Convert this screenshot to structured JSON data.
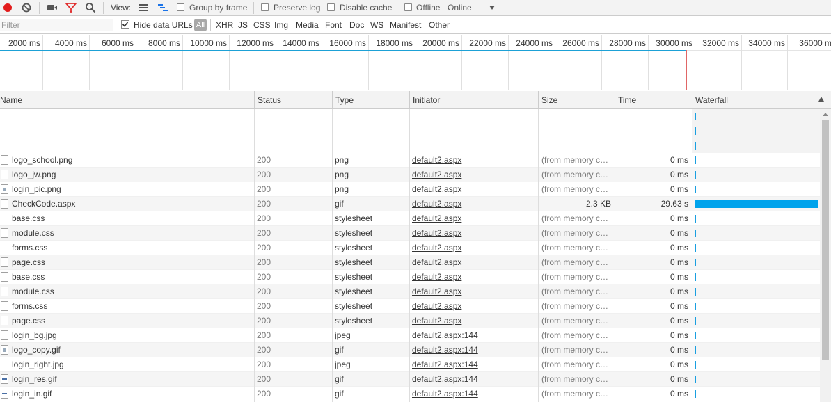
{
  "toolbar": {
    "view_label": "View:",
    "group_by_frame_label": "Group by frame",
    "preserve_log_label": "Preserve log",
    "disable_cache_label": "Disable cache",
    "offline_label": "Offline",
    "throttle_value": "Online",
    "record_color": "#e21b1b",
    "filter_icon_color": "#e03030"
  },
  "filterbar": {
    "placeholder": "Filter",
    "hide_data_urls_label": "Hide data URLs",
    "types": [
      "All",
      "XHR",
      "JS",
      "CSS",
      "Img",
      "Media",
      "Font",
      "Doc",
      "WS",
      "Manifest",
      "Other"
    ]
  },
  "overview": {
    "ticks": [
      "2000 ms",
      "4000 ms",
      "6000 ms",
      "8000 ms",
      "10000 ms",
      "12000 ms",
      "14000 ms",
      "16000 ms",
      "18000 ms",
      "20000 ms",
      "22000 ms",
      "24000 ms",
      "26000 ms",
      "28000 ms",
      "30000 ms",
      "32000 ms",
      "34000 ms",
      "36000 m"
    ]
  },
  "table": {
    "columns": {
      "name": "Name",
      "status": "Status",
      "type": "Type",
      "initiator": "Initiator",
      "size": "Size",
      "time": "Time",
      "waterfall": "Waterfall"
    },
    "rows": [
      {
        "name": "logo_school.png",
        "status": "200",
        "type": "png",
        "initiator": "default2.aspx",
        "size": "(from memory ca...",
        "time": "0 ms",
        "icon": "file-icon"
      },
      {
        "name": "logo_jw.png",
        "status": "200",
        "type": "png",
        "initiator": "default2.aspx",
        "size": "(from memory ca...",
        "time": "0 ms",
        "icon": "file-icon"
      },
      {
        "name": "login_pic.png",
        "status": "200",
        "type": "png",
        "initiator": "default2.aspx",
        "size": "(from memory ca...",
        "time": "0 ms",
        "icon": "image-file-icon"
      },
      {
        "name": "CheckCode.aspx",
        "status": "200",
        "type": "gif",
        "initiator": "default2.aspx",
        "size": "2.3 KB",
        "time": "29.63 s",
        "icon": "file-icon"
      },
      {
        "name": "base.css",
        "status": "200",
        "type": "stylesheet",
        "initiator": "default2.aspx",
        "size": "(from memory ca...",
        "time": "0 ms",
        "icon": "file-icon"
      },
      {
        "name": "module.css",
        "status": "200",
        "type": "stylesheet",
        "initiator": "default2.aspx",
        "size": "(from memory ca...",
        "time": "0 ms",
        "icon": "file-icon"
      },
      {
        "name": "forms.css",
        "status": "200",
        "type": "stylesheet",
        "initiator": "default2.aspx",
        "size": "(from memory ca...",
        "time": "0 ms",
        "icon": "file-icon"
      },
      {
        "name": "page.css",
        "status": "200",
        "type": "stylesheet",
        "initiator": "default2.aspx",
        "size": "(from memory ca...",
        "time": "0 ms",
        "icon": "file-icon"
      },
      {
        "name": "base.css",
        "status": "200",
        "type": "stylesheet",
        "initiator": "default2.aspx",
        "size": "(from memory ca...",
        "time": "0 ms",
        "icon": "file-icon"
      },
      {
        "name": "module.css",
        "status": "200",
        "type": "stylesheet",
        "initiator": "default2.aspx",
        "size": "(from memory ca...",
        "time": "0 ms",
        "icon": "file-icon"
      },
      {
        "name": "forms.css",
        "status": "200",
        "type": "stylesheet",
        "initiator": "default2.aspx",
        "size": "(from memory ca...",
        "time": "0 ms",
        "icon": "file-icon"
      },
      {
        "name": "page.css",
        "status": "200",
        "type": "stylesheet",
        "initiator": "default2.aspx",
        "size": "(from memory ca...",
        "time": "0 ms",
        "icon": "file-icon"
      },
      {
        "name": "login_bg.jpg",
        "status": "200",
        "type": "jpeg",
        "initiator": "default2.aspx:144",
        "size": "(from memory ca...",
        "time": "0 ms",
        "icon": "file-icon"
      },
      {
        "name": "logo_copy.gif",
        "status": "200",
        "type": "gif",
        "initiator": "default2.aspx:144",
        "size": "(from memory ca...",
        "time": "0 ms",
        "icon": "image-file-icon"
      },
      {
        "name": "login_right.jpg",
        "status": "200",
        "type": "jpeg",
        "initiator": "default2.aspx:144",
        "size": "(from memory ca...",
        "time": "0 ms",
        "icon": "file-icon"
      },
      {
        "name": "login_res.gif",
        "status": "200",
        "type": "gif",
        "initiator": "default2.aspx:144",
        "size": "(from memory ca...",
        "time": "0 ms",
        "icon": "line-file-icon"
      },
      {
        "name": "login_in.gif",
        "status": "200",
        "type": "gif",
        "initiator": "default2.aspx:144",
        "size": "(from memory ca...",
        "time": "0 ms",
        "icon": "line-file-icon"
      }
    ]
  }
}
